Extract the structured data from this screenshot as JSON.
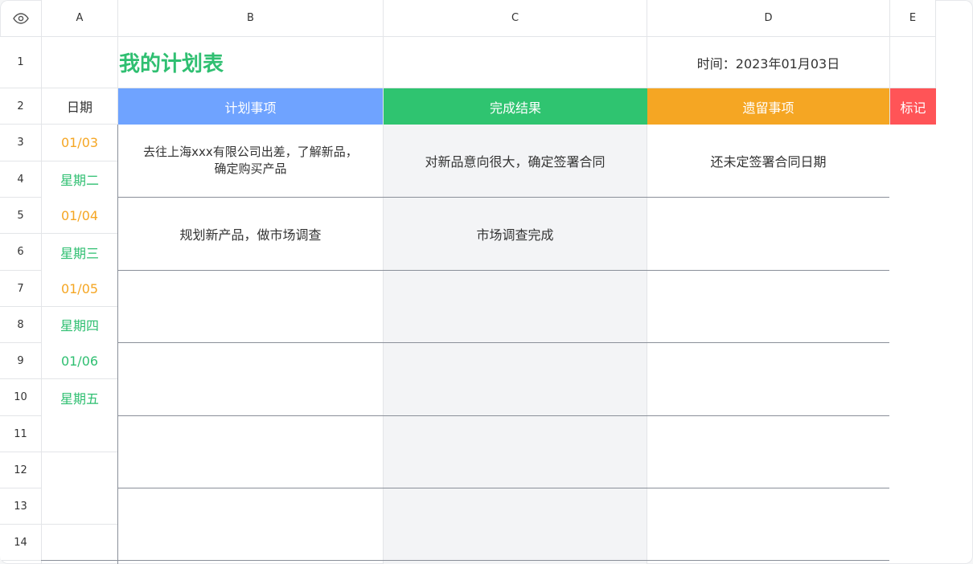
{
  "columns": [
    "A",
    "B",
    "C",
    "D",
    "E"
  ],
  "rows": [
    "1",
    "2",
    "3",
    "4",
    "5",
    "6",
    "7",
    "8",
    "9",
    "10",
    "11",
    "12",
    "13",
    "14"
  ],
  "title": "我的计划表",
  "date_label": "时间：2023年01月03日",
  "headers": {
    "date": "日期",
    "plan": "计划事项",
    "result": "完成结果",
    "pending": "遗留事项",
    "mark": "标记"
  },
  "days": [
    {
      "date": "01/03",
      "weekday": "星期二"
    },
    {
      "date": "01/04",
      "weekday": "星期三"
    },
    {
      "date": "01/05",
      "weekday": "星期四"
    },
    {
      "date": "01/06",
      "weekday": "星期五"
    }
  ],
  "entries": [
    {
      "plan_line1": "去往上海xxx有限公司出差，了解新品，",
      "plan_line2": "确定购买产品",
      "result": "对新品意向很大，确定签署合同",
      "pending": "还未定签署合同日期"
    },
    {
      "plan": "规划新产品，做市场调查",
      "result": "市场调查完成",
      "pending": ""
    }
  ],
  "colors": {
    "title_green": "#2fbf71",
    "plan_blue": "#6fa3ff",
    "result_green": "#2fc470",
    "pending_orange": "#f5a623",
    "mark_red": "#ff5457",
    "date_orange": "#f5a623",
    "weekday_green": "#2fbf71"
  }
}
